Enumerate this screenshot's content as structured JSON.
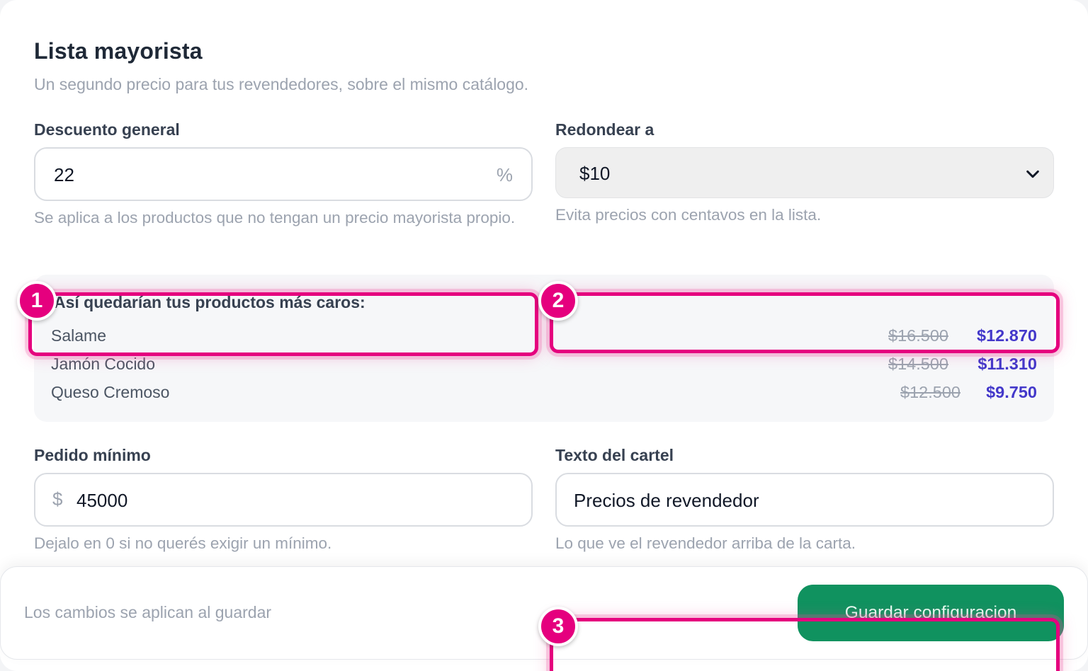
{
  "header": {
    "title": "Lista mayorista",
    "subtitle": "Un segundo precio para tus revendedores, sobre el mismo catálogo."
  },
  "discount": {
    "label": "Descuento general",
    "value": "22",
    "suffix": "%",
    "hint": "Se aplica a los productos que no tengan un precio mayorista propio."
  },
  "rounding": {
    "label": "Redondear a",
    "selected": "$10",
    "hint": "Evita precios con centavos en la lista."
  },
  "preview": {
    "title": "Así quedarían tus productos más caros:",
    "rows": [
      {
        "name": "Salame",
        "old_price": "$16.500",
        "new_price": "$12.870"
      },
      {
        "name": "Jamón Cocido",
        "old_price": "$14.500",
        "new_price": "$11.310"
      },
      {
        "name": "Queso Cremoso",
        "old_price": "$12.500",
        "new_price": "$9.750"
      }
    ]
  },
  "min_order": {
    "label": "Pedido mínimo",
    "prefix": "$",
    "value": "45000",
    "hint": "Dejalo en 0 si no querés exigir un mínimo."
  },
  "banner_text": {
    "label": "Texto del cartel",
    "value": "Precios de revendedor",
    "hint": "Lo que ve el revendedor arriba de la carta."
  },
  "footer": {
    "note": "Los cambios se aplican al guardar",
    "save_label": "Guardar configuracion"
  },
  "annotations": {
    "badge_1": "1",
    "badge_2": "2",
    "badge_3": "3",
    "color": "#e5007e"
  },
  "colors": {
    "accent_new_price": "#4338ca",
    "save_button": "#10925f"
  }
}
